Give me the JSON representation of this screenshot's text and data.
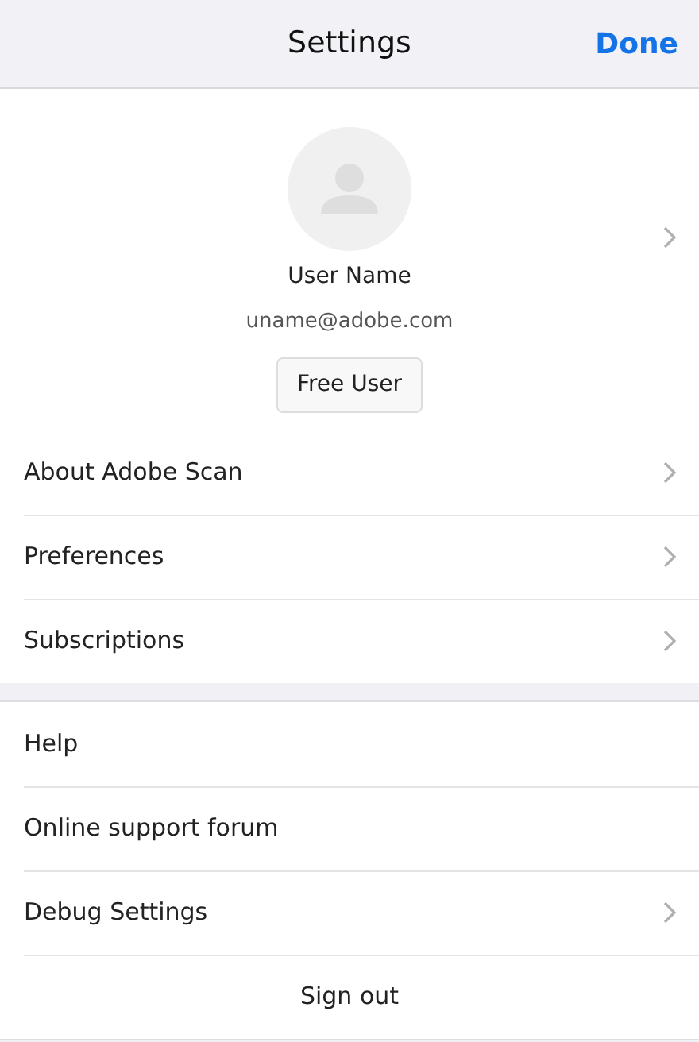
{
  "header": {
    "title": "Settings",
    "done": "Done"
  },
  "profile": {
    "name": "User Name",
    "email": "uname@adobe.com",
    "plan": "Free User",
    "chevron": true
  },
  "sections": [
    {
      "items": [
        {
          "label": "About Adobe Scan",
          "chevron": true,
          "kind": "row"
        },
        {
          "label": "Preferences",
          "chevron": true,
          "kind": "row"
        },
        {
          "label": "Subscriptions",
          "chevron": true,
          "kind": "row"
        }
      ]
    },
    {
      "items": [
        {
          "label": "Help",
          "chevron": false,
          "kind": "row"
        },
        {
          "label": "Online support forum",
          "chevron": false,
          "kind": "row"
        },
        {
          "label": "Debug Settings",
          "chevron": true,
          "kind": "row"
        },
        {
          "label": "Sign out",
          "chevron": false,
          "kind": "action"
        }
      ]
    }
  ]
}
